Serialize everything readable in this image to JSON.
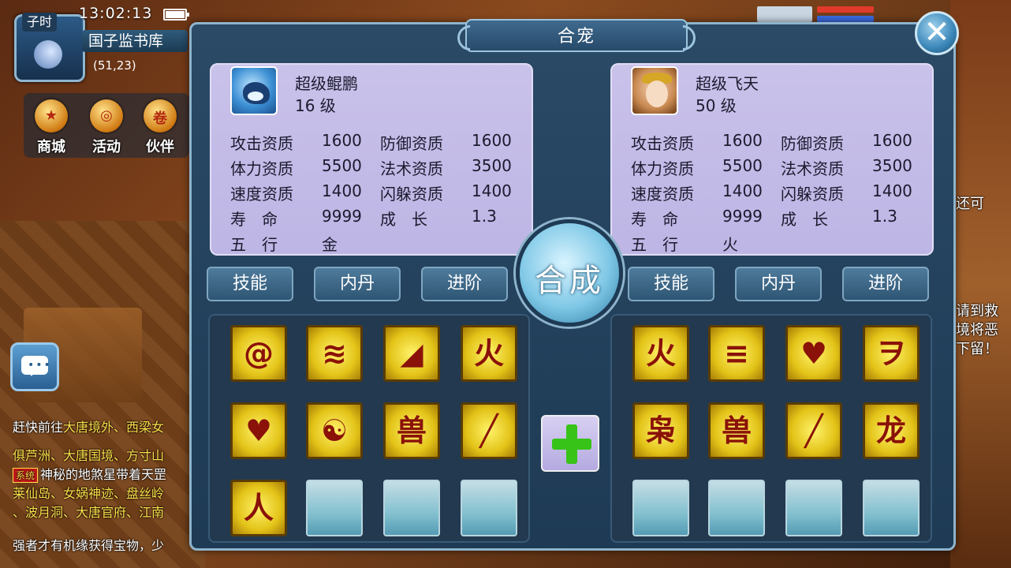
{
  "hud": {
    "time": "13:02:13",
    "shichen": "子时",
    "location": "国子监书库",
    "coords": "(51,23)",
    "menu": [
      {
        "label": "商城",
        "icon": "bag-icon"
      },
      {
        "label": "活动",
        "icon": "gong-icon"
      },
      {
        "label": "伙伴",
        "icon": "scroll-icon"
      }
    ]
  },
  "chat": {
    "lines": [
      {
        "text": "赶快前往",
        "highlight": "大唐境外、西梁女"
      },
      {
        "text": "",
        "highlight": "俱芦洲、大唐国境、方寸山"
      },
      {
        "tag": "系统",
        "text": "神秘的地煞星带着天罡"
      },
      {
        "text": "",
        "highlight": "莱仙岛、女娲神迹、盘丝岭"
      },
      {
        "text": "",
        "highlight": "、波月洞、大唐官府、江南"
      },
      {
        "text": "强者才有机缘获得宝物，少"
      }
    ]
  },
  "right_side": {
    "text1": "还可",
    "text2": "请到救",
    "text3": "境将恶",
    "text4": "下留！"
  },
  "dialog": {
    "title": "合宠",
    "close_label": "✕",
    "combine_label": "合成",
    "tabs": [
      "技能",
      "内丹",
      "进阶"
    ],
    "pets": [
      {
        "name": "超级鲲鹏",
        "level": "16 级",
        "stats": [
          [
            "攻击资质",
            "1600",
            "防御资质",
            "1600"
          ],
          [
            "体力资质",
            "5500",
            "法术资质",
            "3500"
          ],
          [
            "速度资质",
            "1400",
            "闪躲资质",
            "1400"
          ],
          [
            "寿　命",
            "9999",
            "成　长",
            "1.3"
          ],
          [
            "五　行",
            "金",
            "",
            ""
          ]
        ],
        "skills": [
          "swirl-skill-icon",
          "wave-skill-icon",
          "signal-skill-icon",
          "fire-skill-icon",
          "heart-skill-icon",
          "yin-skill-icon",
          "beast-skill-icon",
          "slash-skill-icon",
          "figure-skill-icon",
          "empty",
          "empty",
          "empty"
        ],
        "skill_glyphs": [
          "@",
          "≋",
          "◢",
          "火",
          "♥",
          "☯",
          "兽",
          "╱",
          "人",
          "",
          "",
          ""
        ]
      },
      {
        "name": "超级飞天",
        "level": "50 级",
        "stats": [
          [
            "攻击资质",
            "1600",
            "防御资质",
            "1600"
          ],
          [
            "体力资质",
            "5500",
            "法术资质",
            "3500"
          ],
          [
            "速度资质",
            "1400",
            "闪躲资质",
            "1400"
          ],
          [
            "寿　命",
            "9999",
            "成　长",
            "1.3"
          ],
          [
            "五　行",
            "火",
            "",
            ""
          ]
        ],
        "skills": [
          "fire-skill-icon",
          "dash-skill-icon",
          "heart-skill-icon",
          "rune-skill-icon",
          "owl-skill-icon",
          "beast-skill-icon",
          "slash-skill-icon",
          "dragon-skill-icon",
          "empty",
          "empty",
          "empty",
          "empty"
        ],
        "skill_glyphs": [
          "火",
          "≡",
          "♥",
          "ヲ",
          "枭",
          "兽",
          "╱",
          "龙",
          "",
          "",
          "",
          ""
        ]
      }
    ]
  },
  "colors": {
    "panel": "#1e3a54",
    "card": "#c9c2ea",
    "skill": "#e3c318",
    "accent": "#38c318"
  }
}
